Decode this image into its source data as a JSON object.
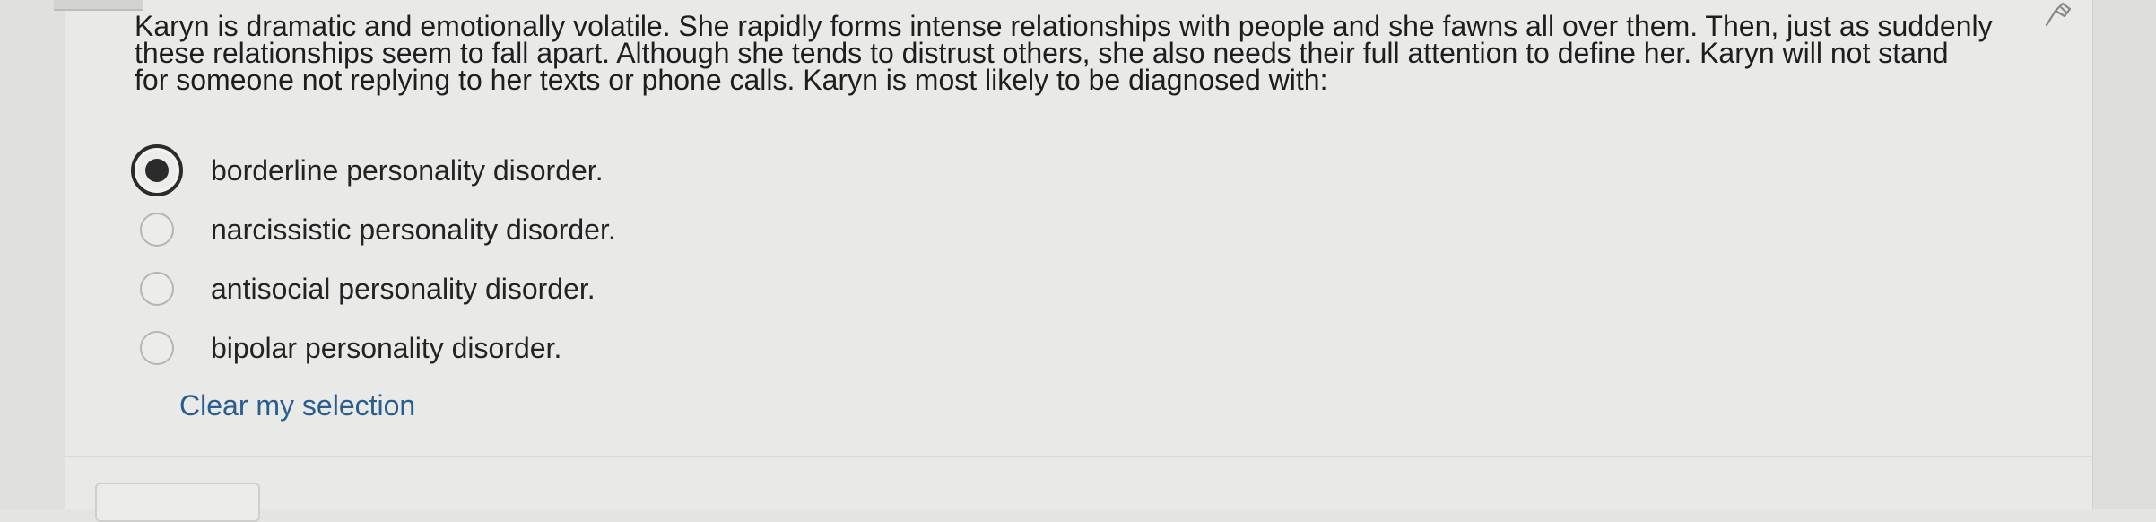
{
  "question": {
    "lines": [
      "Karyn is dramatic and emotionally volatile. She rapidly forms intense relationships with people and she fawns all over them. Then, just as suddenly",
      "these relationships seem to fall apart. Although she tends to distrust others, she also needs their full attention to define her. Karyn will not stand",
      "for someone not replying to her texts or phone calls. Karyn is most likely to be diagnosed with:"
    ]
  },
  "options": [
    {
      "label": "borderline personality disorder.",
      "selected": true
    },
    {
      "label": "narcissistic personality disorder.",
      "selected": false
    },
    {
      "label": "antisocial personality disorder.",
      "selected": false
    },
    {
      "label": "bipolar personality disorder.",
      "selected": false
    }
  ],
  "clear_label": "Clear my selection",
  "icons": {
    "flag": "flag-icon",
    "radio": "radio-button"
  },
  "colors": {
    "link": "#2a5d8f",
    "selected_radio": "#2b2b2b"
  }
}
